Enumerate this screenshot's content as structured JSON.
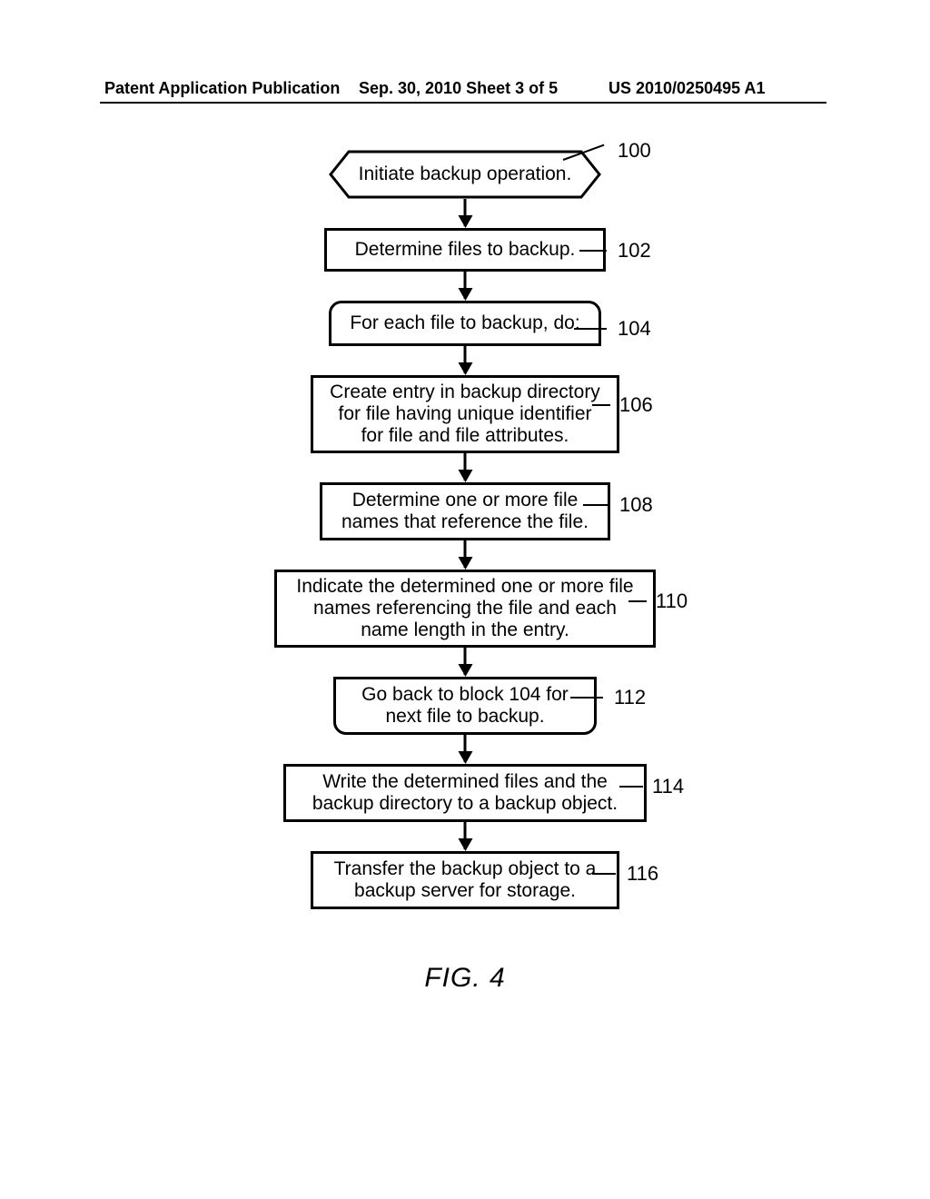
{
  "header": {
    "left": "Patent Application Publication",
    "center": "Sep. 30, 2010  Sheet 3 of 5",
    "right": "US 2010/0250495 A1"
  },
  "steps": {
    "s100": {
      "text": "Initiate backup operation.",
      "ref": "100"
    },
    "s102": {
      "text": "Determine files to backup.",
      "ref": "102"
    },
    "s104": {
      "text": "For each file to backup, do:",
      "ref": "104"
    },
    "s106": {
      "text": "Create entry in backup directory for file having unique identifier for file and file attributes.",
      "ref": "106"
    },
    "s108": {
      "text": "Determine one or more file names that reference the file.",
      "ref": "108"
    },
    "s110": {
      "text": "Indicate the determined one or more file names referencing the file and each name length in the entry.",
      "ref": "110"
    },
    "s112": {
      "text": "Go back to block 104 for next file to backup.",
      "ref": "112"
    },
    "s114": {
      "text": "Write the determined files and the backup directory to a backup object.",
      "ref": "114"
    },
    "s116": {
      "text": "Transfer the backup object to a backup server for storage.",
      "ref": "116"
    }
  },
  "figure": "FIG. 4"
}
